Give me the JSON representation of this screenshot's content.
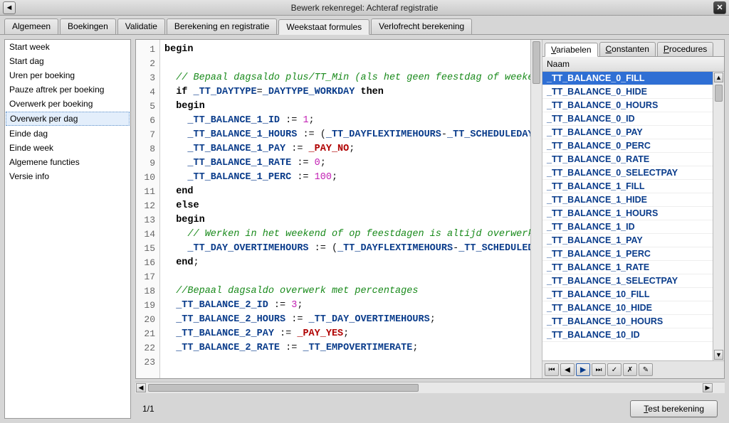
{
  "window": {
    "title": "Bewerk rekenregel: Achteraf registratie"
  },
  "tabs": [
    "Algemeen",
    "Boekingen",
    "Validatie",
    "Berekening en registratie",
    "Weekstaat formules",
    "Verlofrecht berekening"
  ],
  "active_tab_index": 4,
  "sidebar": {
    "items": [
      "Start week",
      "Start dag",
      "Uren per boeking",
      "Pauze aftrek per boeking",
      "Overwerk per boeking",
      "Overwerk per dag",
      "Einde dag",
      "Einde week",
      "Algemene functies",
      "Versie info"
    ],
    "selected_index": 5
  },
  "code": {
    "lines": [
      {
        "n": 1,
        "segments": [
          {
            "t": "begin",
            "c": "kw"
          }
        ]
      },
      {
        "n": 2,
        "segments": []
      },
      {
        "n": 3,
        "segments": [
          {
            "t": "  // Bepaal dagsaldo plus/TT_Min (als het geen feestdag of weekend i",
            "c": "cm"
          }
        ]
      },
      {
        "n": 4,
        "segments": [
          {
            "t": "  ",
            "c": ""
          },
          {
            "t": "if",
            "c": "kw"
          },
          {
            "t": " ",
            "c": ""
          },
          {
            "t": "_TT_DAYTYPE",
            "c": "id"
          },
          {
            "t": "=",
            "c": ""
          },
          {
            "t": "_DAYTYPE_WORKDAY",
            "c": "id"
          },
          {
            "t": " ",
            "c": ""
          },
          {
            "t": "then",
            "c": "kw"
          }
        ]
      },
      {
        "n": 5,
        "segments": [
          {
            "t": "  ",
            "c": ""
          },
          {
            "t": "begin",
            "c": "kw"
          }
        ]
      },
      {
        "n": 6,
        "segments": [
          {
            "t": "    ",
            "c": ""
          },
          {
            "t": "_TT_BALANCE_1_ID",
            "c": "id"
          },
          {
            "t": " := ",
            "c": ""
          },
          {
            "t": "1",
            "c": "num"
          },
          {
            "t": ";",
            "c": ""
          }
        ]
      },
      {
        "n": 7,
        "segments": [
          {
            "t": "    ",
            "c": ""
          },
          {
            "t": "_TT_BALANCE_1_HOURS",
            "c": "id"
          },
          {
            "t": " := (",
            "c": ""
          },
          {
            "t": "_TT_DAYFLEXTIMEHOURS",
            "c": "id"
          },
          {
            "t": "-",
            "c": ""
          },
          {
            "t": "_TT_SCHEDULEDAYHOU",
            "c": "id"
          }
        ]
      },
      {
        "n": 8,
        "segments": [
          {
            "t": "    ",
            "c": ""
          },
          {
            "t": "_TT_BALANCE_1_PAY",
            "c": "id"
          },
          {
            "t": " := ",
            "c": ""
          },
          {
            "t": "_PAY_NO",
            "c": "rc"
          },
          {
            "t": ";",
            "c": ""
          }
        ]
      },
      {
        "n": 9,
        "segments": [
          {
            "t": "    ",
            "c": ""
          },
          {
            "t": "_TT_BALANCE_1_RATE",
            "c": "id"
          },
          {
            "t": " := ",
            "c": ""
          },
          {
            "t": "0",
            "c": "num"
          },
          {
            "t": ";",
            "c": ""
          }
        ]
      },
      {
        "n": 10,
        "segments": [
          {
            "t": "    ",
            "c": ""
          },
          {
            "t": "_TT_BALANCE_1_PERC",
            "c": "id"
          },
          {
            "t": " := ",
            "c": ""
          },
          {
            "t": "100",
            "c": "num"
          },
          {
            "t": ";",
            "c": ""
          }
        ]
      },
      {
        "n": 11,
        "segments": [
          {
            "t": "  ",
            "c": ""
          },
          {
            "t": "end",
            "c": "kw"
          }
        ]
      },
      {
        "n": 12,
        "segments": [
          {
            "t": "  ",
            "c": ""
          },
          {
            "t": "else",
            "c": "kw"
          }
        ]
      },
      {
        "n": 13,
        "segments": [
          {
            "t": "  ",
            "c": ""
          },
          {
            "t": "begin",
            "c": "kw"
          }
        ]
      },
      {
        "n": 14,
        "segments": [
          {
            "t": "    // Werken in het weekend of op feestdagen is altijd overwerk",
            "c": "cm"
          }
        ]
      },
      {
        "n": 15,
        "segments": [
          {
            "t": "    ",
            "c": ""
          },
          {
            "t": "_TT_DAY_OVERTIMEHOURS",
            "c": "id"
          },
          {
            "t": " := (",
            "c": ""
          },
          {
            "t": "_TT_DAYFLEXTIMEHOURS",
            "c": "id"
          },
          {
            "t": "-",
            "c": ""
          },
          {
            "t": "_TT_SCHEDULEDAYH",
            "c": "id"
          }
        ]
      },
      {
        "n": 16,
        "segments": [
          {
            "t": "  ",
            "c": ""
          },
          {
            "t": "end",
            "c": "kw"
          },
          {
            "t": ";",
            "c": ""
          }
        ]
      },
      {
        "n": 17,
        "segments": []
      },
      {
        "n": 18,
        "segments": [
          {
            "t": "  //Bepaal dagsaldo overwerk met percentages",
            "c": "cm"
          }
        ]
      },
      {
        "n": 19,
        "segments": [
          {
            "t": "  ",
            "c": ""
          },
          {
            "t": "_TT_BALANCE_2_ID",
            "c": "id"
          },
          {
            "t": " := ",
            "c": ""
          },
          {
            "t": "3",
            "c": "num"
          },
          {
            "t": ";",
            "c": ""
          }
        ]
      },
      {
        "n": 20,
        "segments": [
          {
            "t": "  ",
            "c": ""
          },
          {
            "t": "_TT_BALANCE_2_HOURS",
            "c": "id"
          },
          {
            "t": " := ",
            "c": ""
          },
          {
            "t": "_TT_DAY_OVERTIMEHOURS",
            "c": "id"
          },
          {
            "t": ";",
            "c": ""
          }
        ]
      },
      {
        "n": 21,
        "segments": [
          {
            "t": "  ",
            "c": ""
          },
          {
            "t": "_TT_BALANCE_2_PAY",
            "c": "id"
          },
          {
            "t": " := ",
            "c": ""
          },
          {
            "t": "_PAY_YES",
            "c": "rc"
          },
          {
            "t": ";",
            "c": ""
          }
        ]
      },
      {
        "n": 22,
        "segments": [
          {
            "t": "  ",
            "c": ""
          },
          {
            "t": "_TT_BALANCE_2_RATE",
            "c": "id"
          },
          {
            "t": " := ",
            "c": ""
          },
          {
            "t": "_TT_EMPOVERTIMERATE",
            "c": "id"
          },
          {
            "t": ";",
            "c": ""
          }
        ]
      },
      {
        "n": 23,
        "segments": []
      }
    ]
  },
  "right_panel": {
    "tabs": [
      "Variabelen",
      "Constanten",
      "Procedures"
    ],
    "active_tab_index": 0,
    "header": "Naam",
    "selected_index": 0,
    "items": [
      "_TT_BALANCE_0_FILL",
      "_TT_BALANCE_0_HIDE",
      "_TT_BALANCE_0_HOURS",
      "_TT_BALANCE_0_ID",
      "_TT_BALANCE_0_PAY",
      "_TT_BALANCE_0_PERC",
      "_TT_BALANCE_0_RATE",
      "_TT_BALANCE_0_SELECTPAY",
      "_TT_BALANCE_1_FILL",
      "_TT_BALANCE_1_HIDE",
      "_TT_BALANCE_1_HOURS",
      "_TT_BALANCE_1_ID",
      "_TT_BALANCE_1_PAY",
      "_TT_BALANCE_1_PERC",
      "_TT_BALANCE_1_RATE",
      "_TT_BALANCE_1_SELECTPAY",
      "_TT_BALANCE_10_FILL",
      "_TT_BALANCE_10_HIDE",
      "_TT_BALANCE_10_HOURS",
      "_TT_BALANCE_10_ID"
    ]
  },
  "nav_buttons": [
    "⏮",
    "◀",
    "▶",
    "⏭",
    "✓",
    "✗",
    "✎"
  ],
  "status": {
    "page": "1/1"
  },
  "buttons": {
    "test": "Test berekening"
  }
}
